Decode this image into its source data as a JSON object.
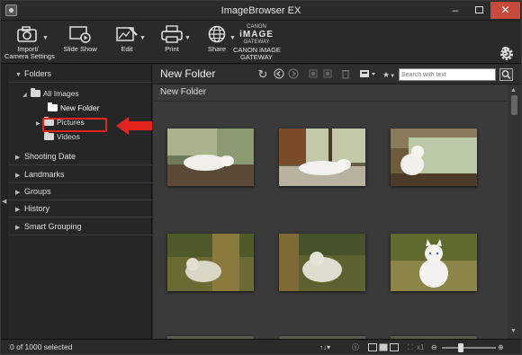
{
  "window": {
    "title": "ImageBrowser EX",
    "minimize": "–",
    "close": "✕"
  },
  "toolbar": {
    "import_label_1": "Import/",
    "import_label_2": "Camera Settings",
    "slideshow_label": "Slide Show",
    "edit_label": "Edit",
    "print_label": "Print",
    "share_label": "Share",
    "gateway_logo_top": "CANON",
    "gateway_logo_main": "iMAGE",
    "gateway_logo_bottom": "GATEWAY",
    "gateway_label_1": "CANON iMAGE",
    "gateway_label_2": "GATEWAY",
    "help": "?"
  },
  "sidebar": {
    "folders_heading": "Folders",
    "tree": {
      "all_images": "All Images",
      "new_folder": "New Folder",
      "pictures": "Pictures",
      "videos": "Videos"
    },
    "sections": [
      "Shooting Date",
      "Landmarks",
      "Groups",
      "History",
      "Smart Grouping"
    ]
  },
  "main": {
    "title": "New Folder",
    "subtitle": "New Folder",
    "search_placeholder": "Search with text",
    "sort_label": "★",
    "thumbnails": [
      {
        "name": "cat-sleeping-window-1",
        "caption": ""
      },
      {
        "name": "cat-lying-floor-window",
        "caption": ""
      },
      {
        "name": "cat-sitting-by-window",
        "caption": ""
      },
      {
        "name": "cat-resting-grass-1",
        "caption": ""
      },
      {
        "name": "cat-resting-grass-2",
        "caption": ""
      },
      {
        "name": "cat-sitting-garden",
        "caption": ""
      }
    ]
  },
  "statusbar": {
    "selection": "0 of 1000 selected",
    "zoom_value": "x1"
  },
  "colors": {
    "highlight": "#e2241c",
    "background": "#262626",
    "content_bg": "#3a3a3a"
  }
}
